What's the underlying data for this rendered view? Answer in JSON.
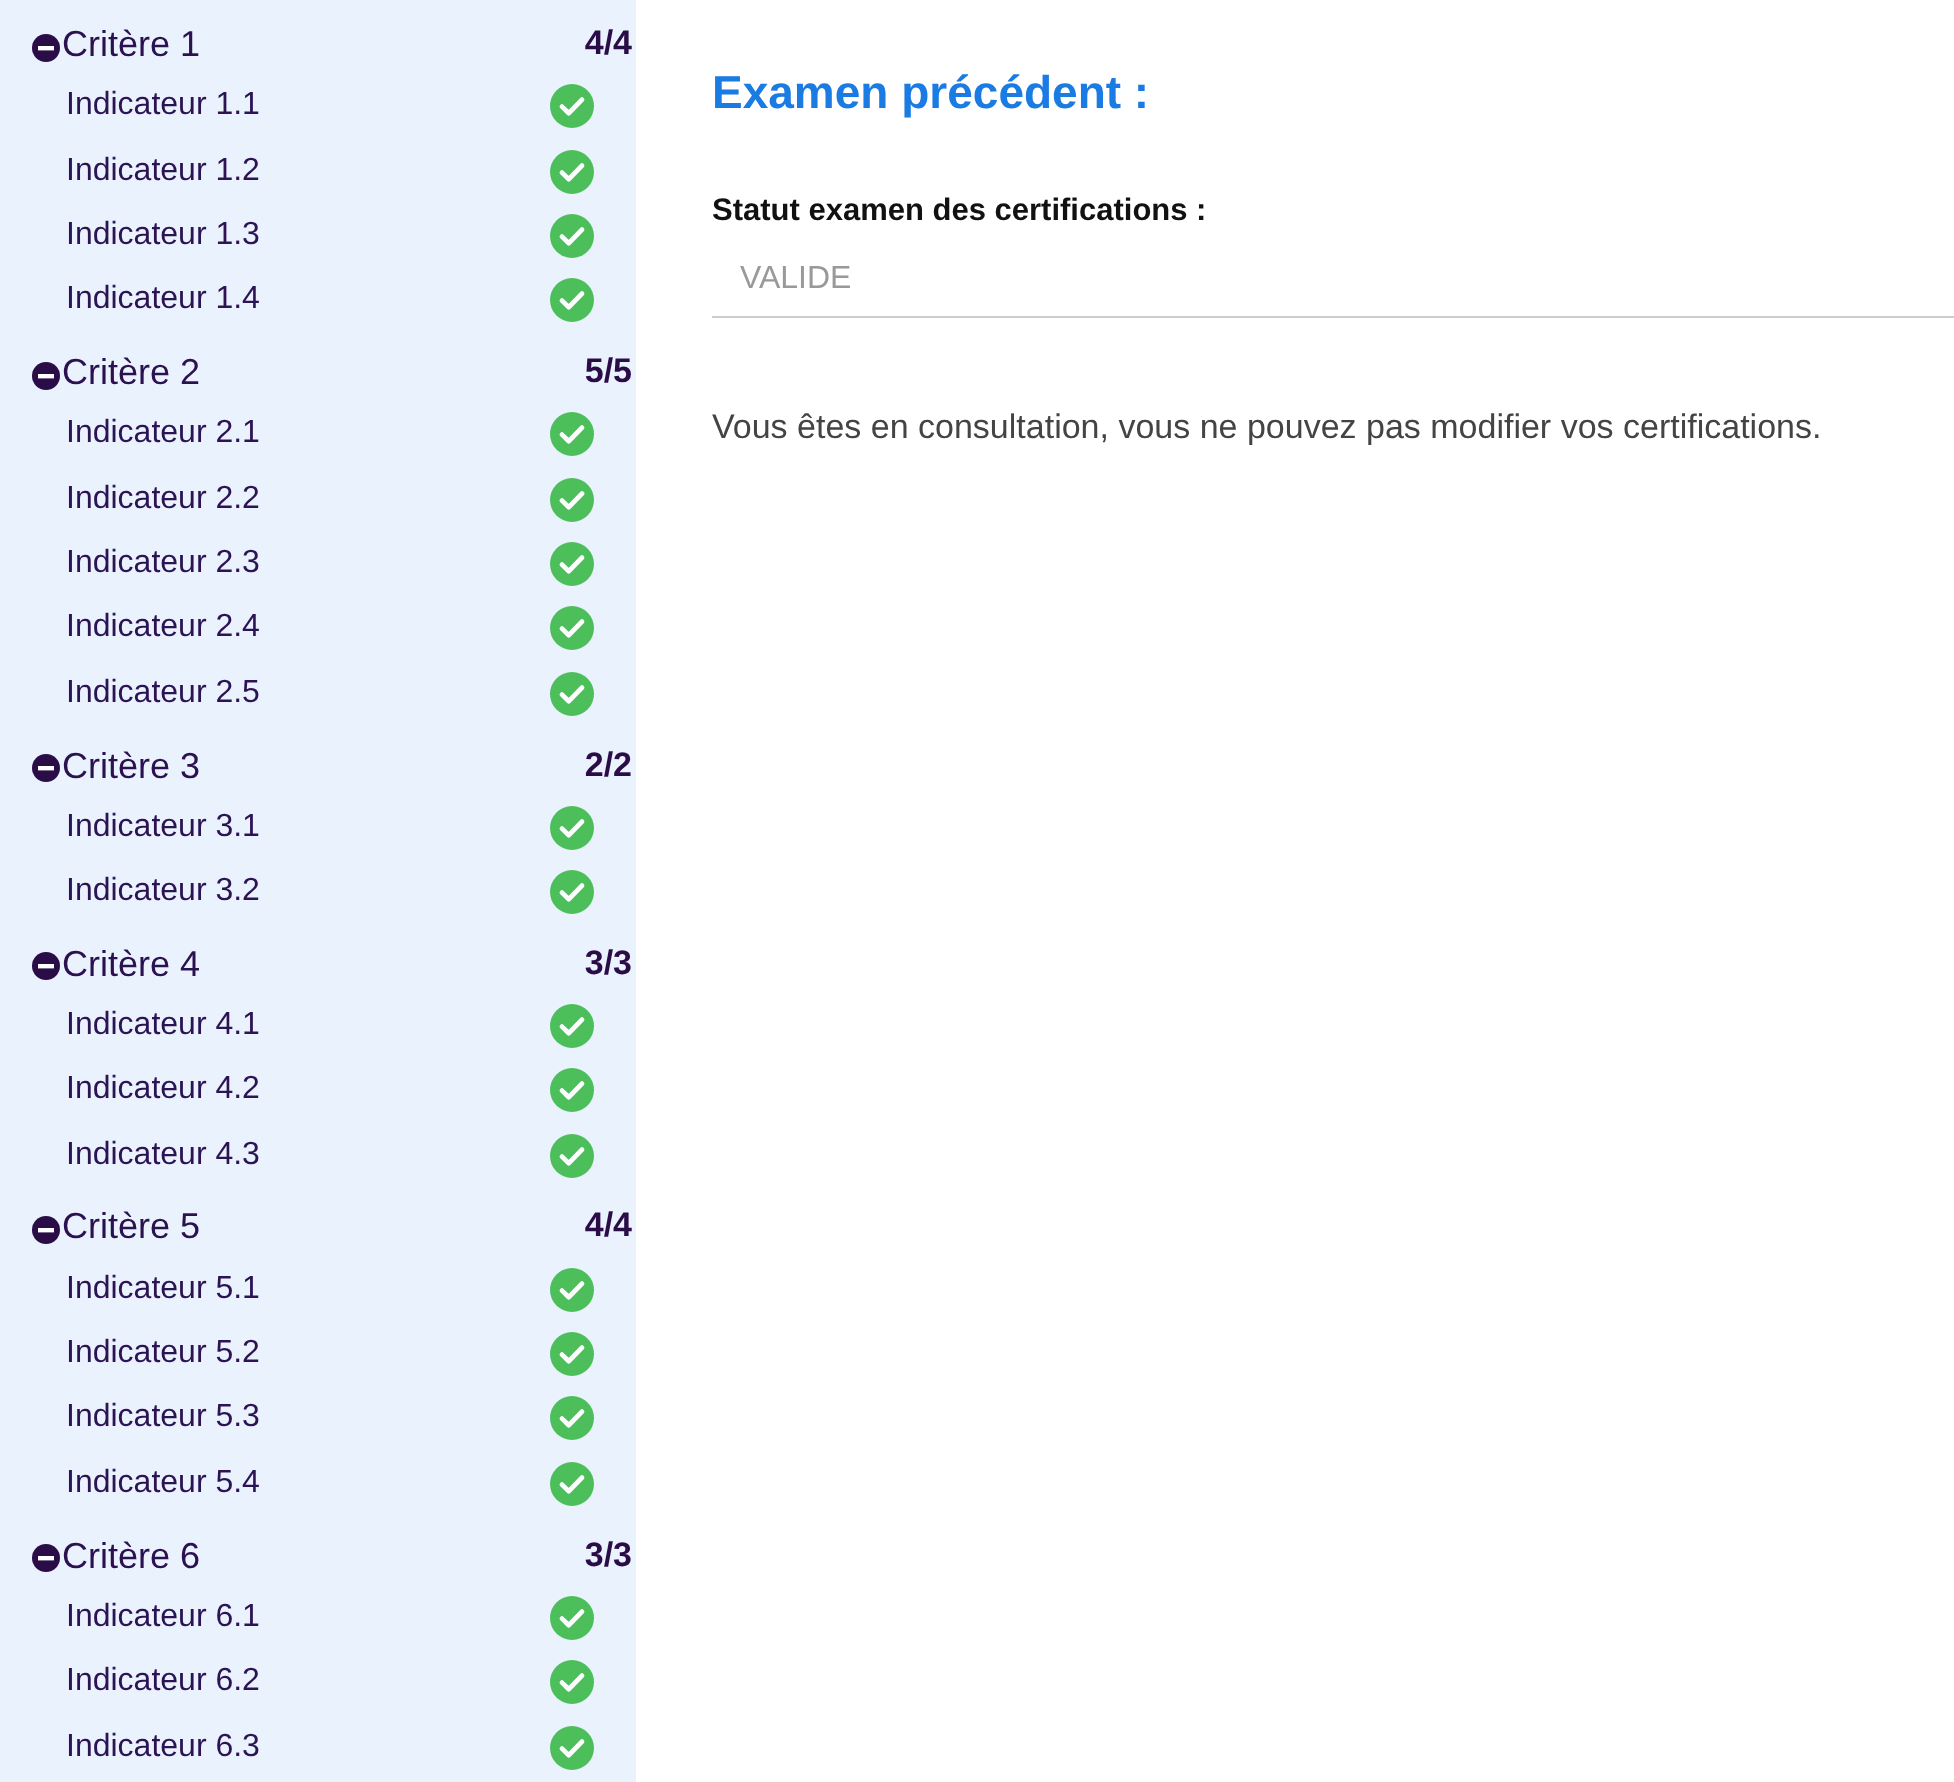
{
  "sidebar": {
    "criteria": [
      {
        "label": "Critère 1",
        "count": "4/4",
        "expanded": true,
        "children": [
          {
            "label": "Indicateur 1.1",
            "completed": true
          },
          {
            "label": "Indicateur 1.2",
            "completed": true
          },
          {
            "label": "Indicateur 1.3",
            "completed": true
          },
          {
            "label": "Indicateur 1.4",
            "completed": true
          }
        ]
      },
      {
        "label": "Critère 2",
        "count": "5/5",
        "expanded": true,
        "children": [
          {
            "label": "Indicateur 2.1",
            "completed": true
          },
          {
            "label": "Indicateur 2.2",
            "completed": true
          },
          {
            "label": "Indicateur 2.3",
            "completed": true
          },
          {
            "label": "Indicateur 2.4",
            "completed": true
          },
          {
            "label": "Indicateur 2.5",
            "completed": true
          }
        ]
      },
      {
        "label": "Critère 3",
        "count": "2/2",
        "expanded": true,
        "children": [
          {
            "label": "Indicateur 3.1",
            "completed": true
          },
          {
            "label": "Indicateur 3.2",
            "completed": true
          }
        ]
      },
      {
        "label": "Critère 4",
        "count": "3/3",
        "expanded": true,
        "children": [
          {
            "label": "Indicateur 4.1",
            "completed": true
          },
          {
            "label": "Indicateur 4.2",
            "completed": true
          },
          {
            "label": "Indicateur 4.3",
            "completed": true
          }
        ]
      },
      {
        "label": "Critère 5",
        "count": "4/4",
        "expanded": true,
        "children": [
          {
            "label": "Indicateur 5.1",
            "completed": true
          },
          {
            "label": "Indicateur 5.2",
            "completed": true
          },
          {
            "label": "Indicateur 5.3",
            "completed": true
          },
          {
            "label": "Indicateur 5.4",
            "completed": true
          }
        ]
      },
      {
        "label": "Critère 6",
        "count": "3/3",
        "expanded": true,
        "children": [
          {
            "label": "Indicateur 6.1",
            "completed": true
          },
          {
            "label": "Indicateur 6.2",
            "completed": true
          },
          {
            "label": "Indicateur 6.3",
            "completed": true
          }
        ]
      }
    ]
  },
  "main": {
    "title": "Examen précédent :",
    "field": {
      "label": "Statut examen des certifications :",
      "value": "VALIDE",
      "disabled": true
    },
    "notice": "Vous êtes en consultation, vous ne pouvez pas modifier vos certifications."
  }
}
